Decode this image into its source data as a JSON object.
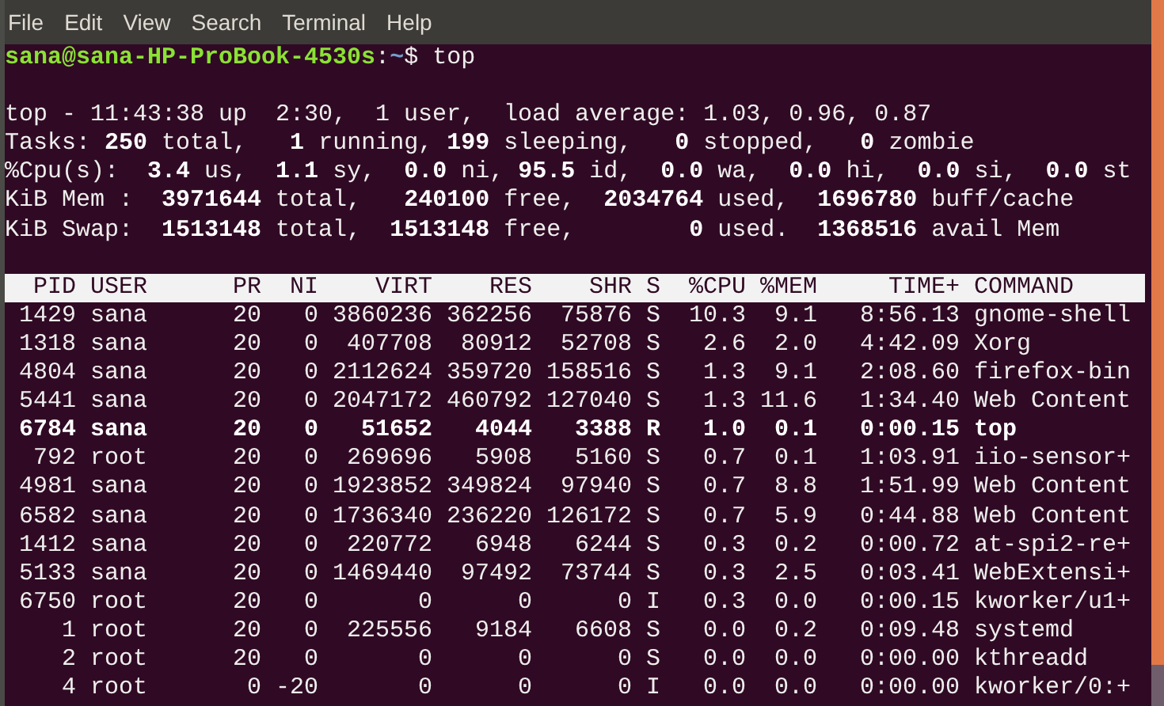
{
  "menu": [
    "File",
    "Edit",
    "View",
    "Search",
    "Terminal",
    "Help"
  ],
  "prompt": {
    "user_host": "sana@sana-HP-ProBook-4530s",
    "separator": ":",
    "path": "~",
    "symbol": "$",
    "command": "top"
  },
  "summary": [
    "top - 11:43:38 up  2:30,  1 user,  load average: 1.03, 0.96, 0.87",
    "Tasks: **250** total,   **1** running, **199** sleeping,   **0** stopped,   **0** zombie",
    "%Cpu(s):  **3.4** us,  **1.1** sy,  **0.0** ni, **95.5** id,  **0.0** wa,  **0.0** hi,  **0.0** si,  **0.0** st",
    "KiB Mem :  **3971644** total,   **240100** free,  **2034764** used,  **1696780** buff/cache",
    "KiB Swap:  **1513148** total,  **1513148** free,        **0** used.  **1368516** avail Mem"
  ],
  "table": {
    "columns": [
      "PID",
      "USER",
      "PR",
      "NI",
      "VIRT",
      "RES",
      "SHR",
      "S",
      "%CPU",
      "%MEM",
      "TIME+",
      "COMMAND"
    ],
    "rows": [
      {
        "bold": false,
        "cells": [
          "1429",
          "sana",
          "20",
          "0",
          "3860236",
          "362256",
          "75876",
          "S",
          "10.3",
          "9.1",
          "8:56.13",
          "gnome-shell"
        ]
      },
      {
        "bold": false,
        "cells": [
          "1318",
          "sana",
          "20",
          "0",
          "407708",
          "80912",
          "52708",
          "S",
          "2.6",
          "2.0",
          "4:42.09",
          "Xorg"
        ]
      },
      {
        "bold": false,
        "cells": [
          "4804",
          "sana",
          "20",
          "0",
          "2112624",
          "359720",
          "158516",
          "S",
          "1.3",
          "9.1",
          "2:08.60",
          "firefox-bin"
        ]
      },
      {
        "bold": false,
        "cells": [
          "5441",
          "sana",
          "20",
          "0",
          "2047172",
          "460792",
          "127040",
          "S",
          "1.3",
          "11.6",
          "1:34.40",
          "Web Content"
        ]
      },
      {
        "bold": true,
        "cells": [
          "6784",
          "sana",
          "20",
          "0",
          "51652",
          "4044",
          "3388",
          "R",
          "1.0",
          "0.1",
          "0:00.15",
          "top"
        ]
      },
      {
        "bold": false,
        "cells": [
          "792",
          "root",
          "20",
          "0",
          "269696",
          "5908",
          "5160",
          "S",
          "0.7",
          "0.1",
          "1:03.91",
          "iio-sensor+"
        ]
      },
      {
        "bold": false,
        "cells": [
          "4981",
          "sana",
          "20",
          "0",
          "1923852",
          "349824",
          "97940",
          "S",
          "0.7",
          "8.8",
          "1:51.99",
          "Web Content"
        ]
      },
      {
        "bold": false,
        "cells": [
          "6582",
          "sana",
          "20",
          "0",
          "1736340",
          "236220",
          "126172",
          "S",
          "0.7",
          "5.9",
          "0:44.88",
          "Web Content"
        ]
      },
      {
        "bold": false,
        "cells": [
          "1412",
          "sana",
          "20",
          "0",
          "220772",
          "6948",
          "6244",
          "S",
          "0.3",
          "0.2",
          "0:00.72",
          "at-spi2-re+"
        ]
      },
      {
        "bold": false,
        "cells": [
          "5133",
          "sana",
          "20",
          "0",
          "1469440",
          "97492",
          "73744",
          "S",
          "0.3",
          "2.5",
          "0:03.41",
          "WebExtensi+"
        ]
      },
      {
        "bold": false,
        "cells": [
          "6750",
          "root",
          "20",
          "0",
          "0",
          "0",
          "0",
          "I",
          "0.3",
          "0.0",
          "0:00.15",
          "kworker/u1+"
        ]
      },
      {
        "bold": false,
        "cells": [
          "1",
          "root",
          "20",
          "0",
          "225556",
          "9184",
          "6608",
          "S",
          "0.0",
          "0.2",
          "0:09.48",
          "systemd"
        ]
      },
      {
        "bold": false,
        "cells": [
          "2",
          "root",
          "20",
          "0",
          "0",
          "0",
          "0",
          "S",
          "0.0",
          "0.0",
          "0:00.00",
          "kthreadd"
        ]
      },
      {
        "bold": false,
        "cells": [
          "4",
          "root",
          "0",
          "-20",
          "0",
          "0",
          "0",
          "I",
          "0.0",
          "0.0",
          "0:00.00",
          "kworker/0:+"
        ]
      }
    ]
  }
}
